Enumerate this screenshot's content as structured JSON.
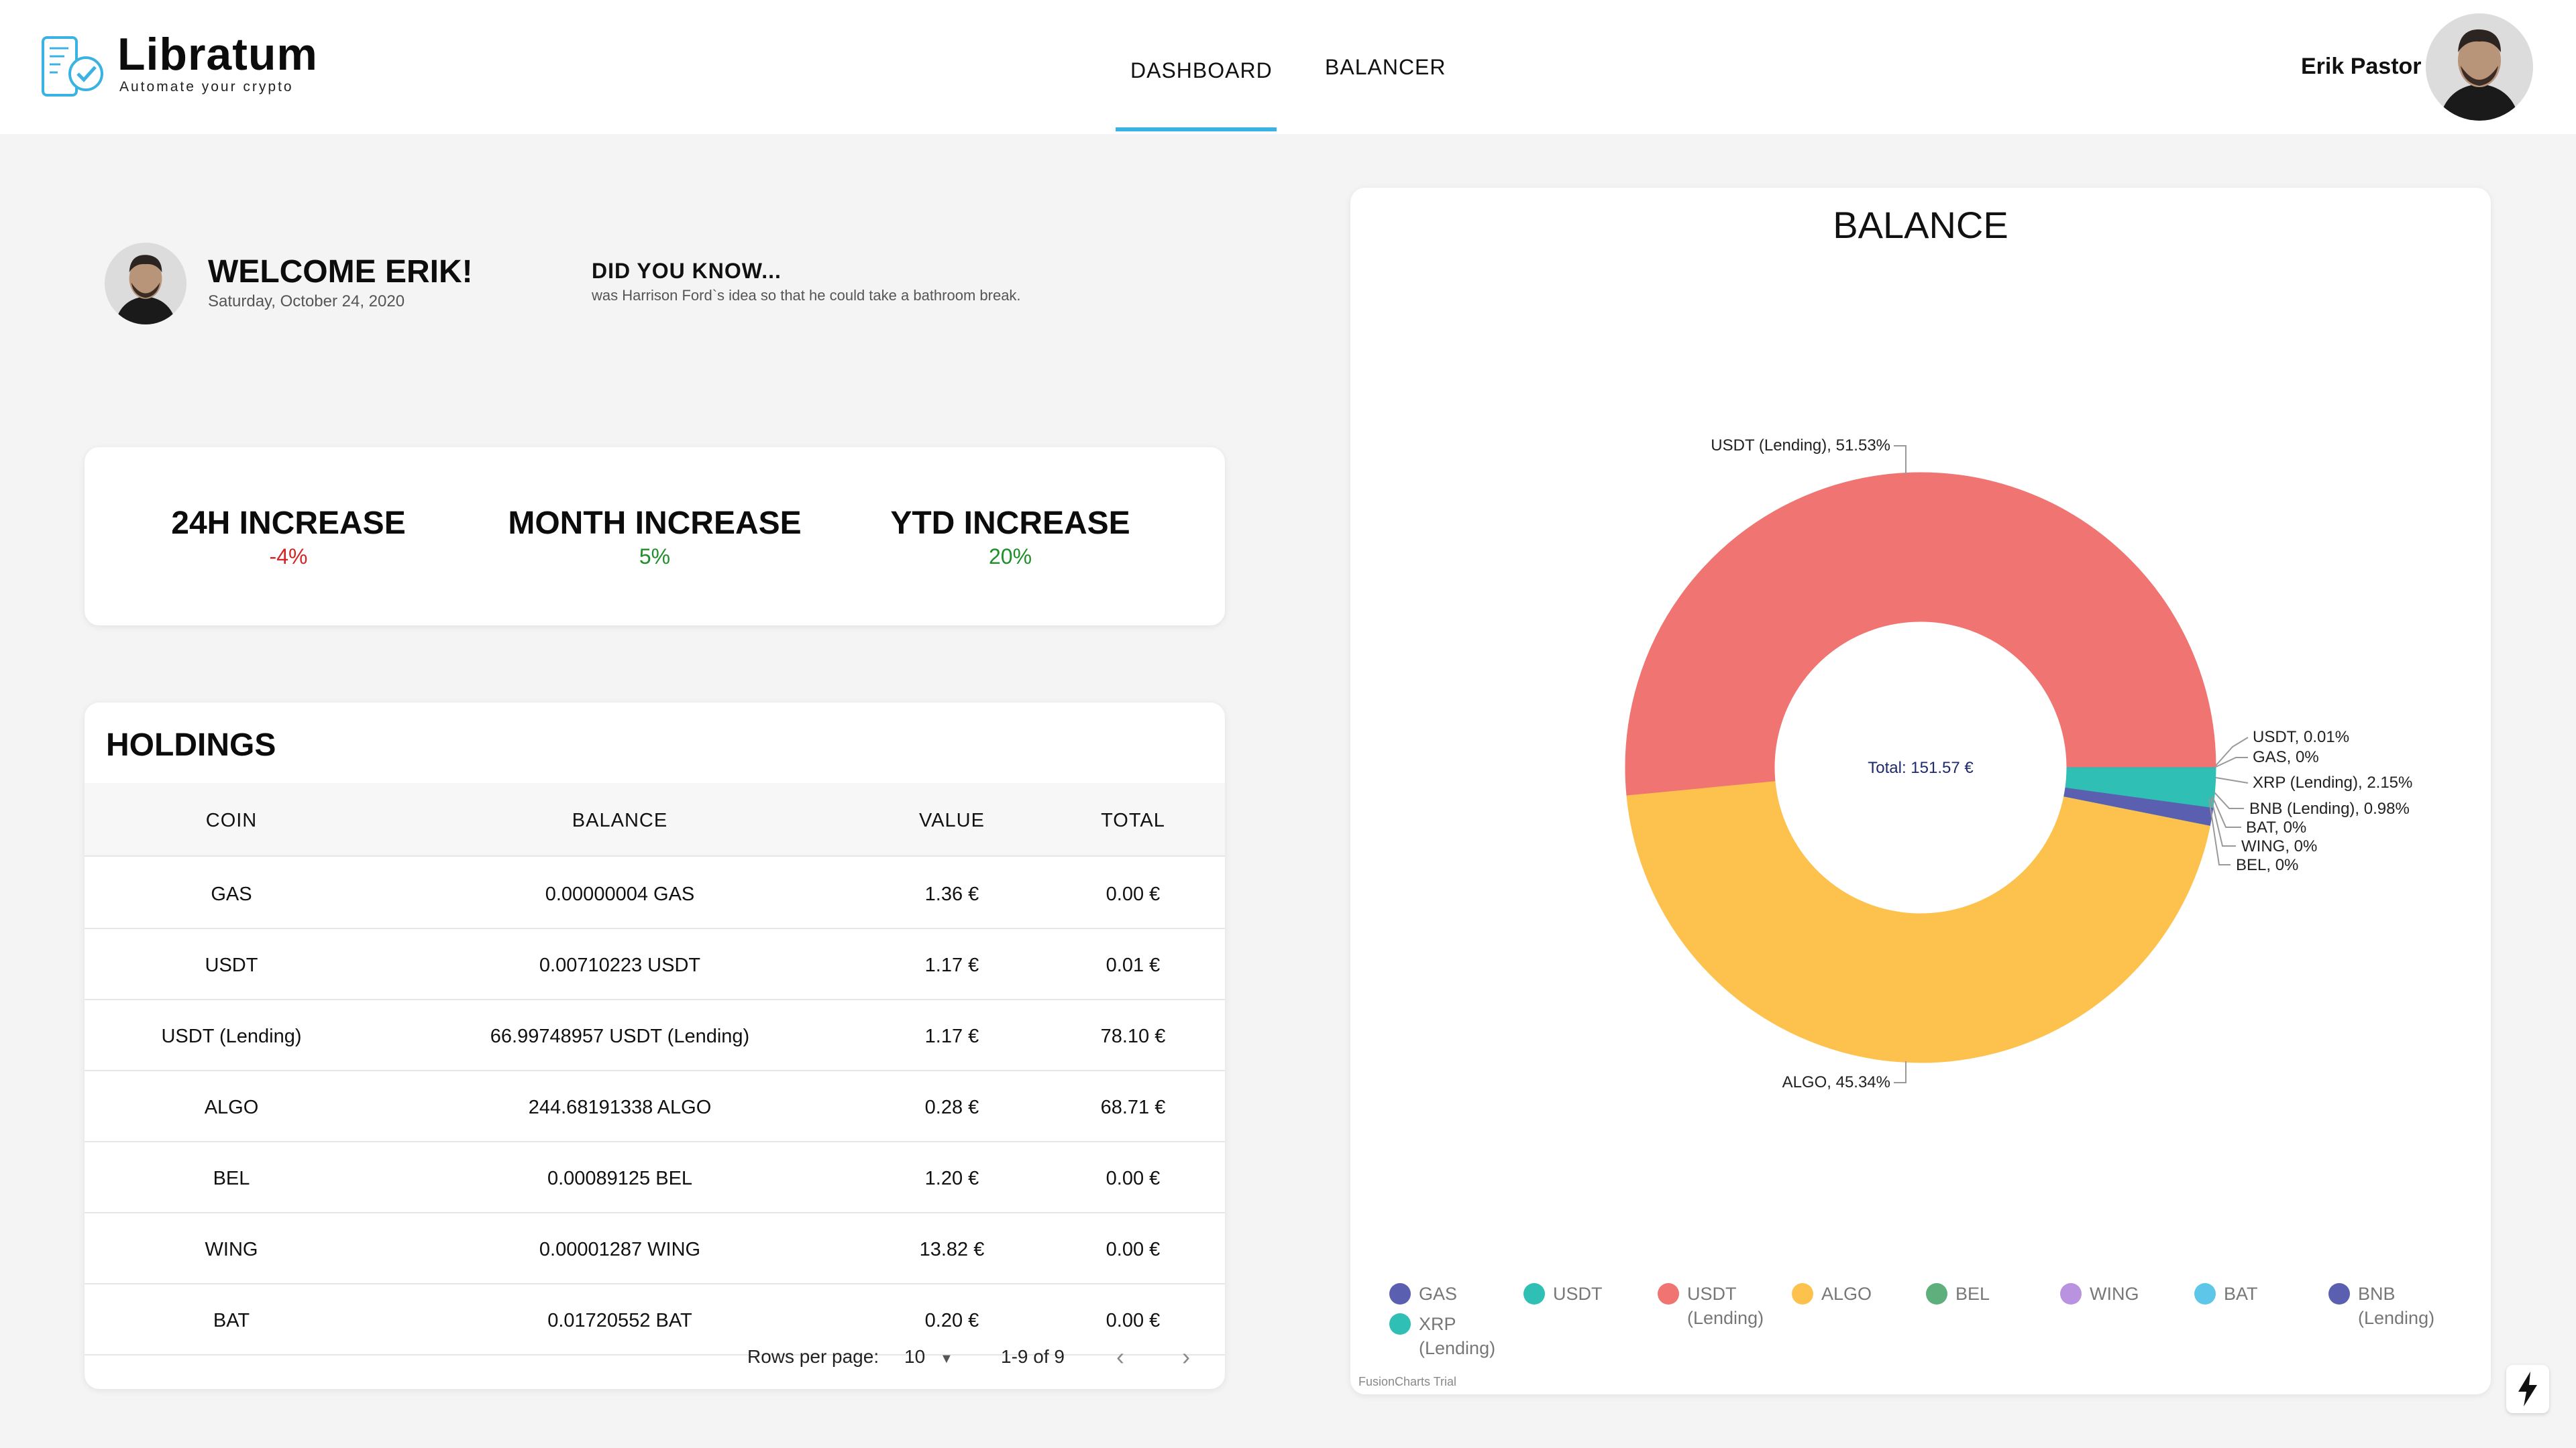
{
  "brand": {
    "name": "Libratum",
    "tagline": "Automate your crypto",
    "accent": "#3bb3e2"
  },
  "nav": {
    "dashboard": "DASHBOARD",
    "balancer": "BALANCER"
  },
  "user": {
    "name": "Erik Pastor"
  },
  "welcome": {
    "title": "WELCOME ERIK!",
    "date": "Saturday, October 24, 2020"
  },
  "did_you_know": {
    "title": "DID YOU KNOW...",
    "text": "was Harrison Ford`s idea so that he could take a bathroom break."
  },
  "stats": [
    {
      "label": "24H INCREASE",
      "value": "-4%",
      "trend": "negative"
    },
    {
      "label": "MONTH INCREASE",
      "value": "5%",
      "trend": "positive"
    },
    {
      "label": "YTD INCREASE",
      "value": "20%",
      "trend": "positive"
    }
  ],
  "holdings": {
    "title": "HOLDINGS",
    "columns": [
      "COIN",
      "BALANCE",
      "VALUE",
      "TOTAL"
    ],
    "rows": [
      [
        "GAS",
        "0.00000004 GAS",
        "1.36 €",
        "0.00 €"
      ],
      [
        "USDT",
        "0.00710223 USDT",
        "1.17 €",
        "0.01 €"
      ],
      [
        "USDT (Lending)",
        "66.99748957 USDT (Lending)",
        "1.17 €",
        "78.10 €"
      ],
      [
        "ALGO",
        "244.68191338 ALGO",
        "0.28 €",
        "68.71 €"
      ],
      [
        "BEL",
        "0.00089125 BEL",
        "1.20 €",
        "0.00 €"
      ],
      [
        "WING",
        "0.00001287 WING",
        "13.82 €",
        "0.00 €"
      ],
      [
        "BAT",
        "0.01720552 BAT",
        "0.20 €",
        "0.00 €"
      ]
    ],
    "pagination": {
      "rows_per_page_label": "Rows per page:",
      "rows_per_page": "10",
      "range": "1-9 of 9"
    }
  },
  "chart_data": {
    "type": "pie",
    "title": "BALANCE",
    "center_label": "Total: 151.57 €",
    "slices": [
      {
        "label": "USDT (Lending)",
        "value": 51.53,
        "display": "USDT (Lending), 51.53%",
        "color": "#ef7472"
      },
      {
        "label": "USDT",
        "value": 0.01,
        "display": "USDT, 0.01%",
        "color": "#2fbfb5"
      },
      {
        "label": "GAS",
        "value": 0,
        "display": "GAS, 0%",
        "color": "#5b5fb0"
      },
      {
        "label": "XRP (Lending)",
        "value": 2.15,
        "display": "XRP (Lending), 2.15%",
        "color": "#2fbfb5"
      },
      {
        "label": "BNB (Lending)",
        "value": 0.98,
        "display": "BNB (Lending), 0.98%",
        "color": "#5b5fb0"
      },
      {
        "label": "BAT",
        "value": 0,
        "display": "BAT, 0%",
        "color": "#5ec6e8"
      },
      {
        "label": "WING",
        "value": 0,
        "display": "WING, 0%",
        "color": "#b992e0"
      },
      {
        "label": "BEL",
        "value": 0,
        "display": "BEL, 0%",
        "color": "#5faf7d"
      },
      {
        "label": "ALGO",
        "value": 45.34,
        "display": "ALGO, 45.34%",
        "color": "#fdc24e"
      }
    ],
    "legend": [
      {
        "label": "GAS",
        "color": "#5b5fb0"
      },
      {
        "label": "USDT",
        "color": "#2fbfb5"
      },
      {
        "label": "USDT (Lending)",
        "color": "#ef7472"
      },
      {
        "label": "ALGO",
        "color": "#fdc24e"
      },
      {
        "label": "BEL",
        "color": "#5faf7d"
      },
      {
        "label": "WING",
        "color": "#b992e0"
      },
      {
        "label": "BAT",
        "color": "#5ec6e8"
      },
      {
        "label": "BNB (Lending)",
        "color": "#5b5fb0"
      },
      {
        "label": "XRP (Lending)",
        "color": "#2fbfb5"
      }
    ],
    "footer": "FusionCharts Trial"
  }
}
